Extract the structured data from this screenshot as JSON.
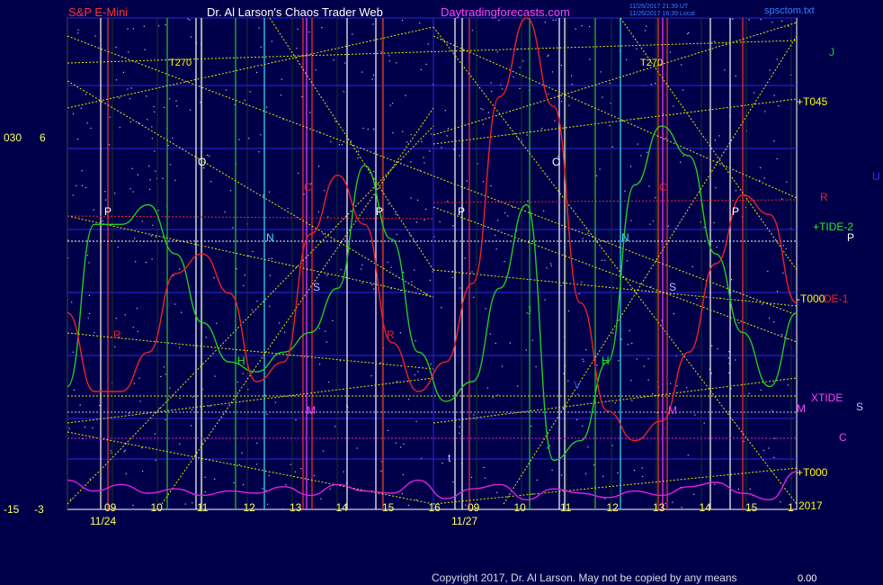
{
  "header": {
    "instrument": "S&P E-Mini",
    "site": "Dr. Al Larson's Chaos Trader Web",
    "url": "Daytradingforecasts.com",
    "stamp_line1": "11/26/2017 21:39 UT",
    "stamp_line2": "11/26/2017 16:39 Local",
    "filename": "spsctom.txt"
  },
  "footer": {
    "copyright": "Copyright 2017, Dr. Al Larson. May not be copied by any means",
    "corner_value": "0.00"
  },
  "left_scale": {
    "top_left": "030",
    "top_right": "6",
    "bottom_left": "-15",
    "bottom_right": "-3"
  },
  "right_labels": {
    "j": "J",
    "t045": "+T045",
    "u": "U",
    "r": "R",
    "tide2": "+TIDE-2",
    "p": "P",
    "t000": "-T000",
    "de1": "DE-1",
    "xtide": "XTIDE",
    "s": "S",
    "m": "M",
    "c": "C",
    "t000b": "+T000",
    "year": "2017"
  },
  "x_axis": {
    "day1_date": "11/24",
    "day2_date": "11/27",
    "day1_hours": [
      "09",
      "10",
      "11",
      "12",
      "13",
      "14",
      "15",
      "16"
    ],
    "day2_hours": [
      "09",
      "10",
      "11",
      "12",
      "13",
      "14",
      "15"
    ],
    "day2_last_hour": "1"
  },
  "in_plot_labels": {
    "t270a": "T270",
    "t270b": "T270",
    "o1": "O",
    "o2": "O",
    "p1": "P",
    "p2": "P",
    "p3": "P",
    "p4": "P",
    "n1": "N",
    "n2": "N",
    "s1": "S",
    "s2": "S",
    "h1": "H",
    "h2": "H",
    "m1": "M",
    "m2": "M",
    "c1": "C",
    "c2": "C",
    "j1": "J",
    "r1": "R",
    "r2": "R",
    "v1": "V",
    "t1": "t"
  },
  "colors": {
    "background": "#00004a",
    "grid": "#2a2ae0",
    "green_curve": "#22cc22",
    "red_curve": "#ee2222",
    "magenta_curve": "#e020e0",
    "yellow_lines": "#e8e800",
    "white_lines": "#ffffff",
    "title_red": "#ff3030",
    "title_white": "#ffffff",
    "url_magenta": "#ff40ff"
  },
  "chart_data": {
    "type": "line",
    "title": "S&P E-Mini",
    "left_axis_range": [
      -15,
      30
    ],
    "right_axis_range": [
      -3,
      6
    ],
    "days": [
      "11/24",
      "11/27"
    ],
    "series": [
      {
        "name": "+TIDE-2",
        "values": [
          0.25,
          0.58,
          0.58,
          0.62,
          0.52,
          0.38,
          0.3,
          0.28,
          0.32,
          0.36,
          0.45,
          0.7,
          0.55,
          0.32,
          0.22,
          0.26,
          0.45,
          0.62,
          0.1,
          0.14,
          0.3,
          0.66,
          0.78,
          0.72,
          0.52,
          0.36,
          0.25,
          0.4
        ]
      },
      {
        "name": "DE-1",
        "values": [
          0.4,
          0.24,
          0.24,
          0.32,
          0.48,
          0.52,
          0.44,
          0.26,
          0.3,
          0.56,
          0.68,
          0.58,
          0.34,
          0.24,
          0.3,
          0.46,
          0.84,
          1.0,
          0.82,
          0.42,
          0.2,
          0.14,
          0.18,
          0.32,
          0.5,
          0.64,
          0.6,
          0.42
        ]
      },
      {
        "name": "XTIDE",
        "values": [
          0.22,
          0.12,
          0.18,
          0.1,
          0.14,
          0.08,
          0.12,
          0.1,
          0.16,
          0.08,
          0.18,
          0.12,
          0.1,
          0.22,
          0.05,
          0.14,
          0.18,
          0.04,
          0.14,
          0.1,
          0.06,
          0.12,
          0.08,
          0.16,
          0.2,
          0.1,
          0.04,
          0.3
        ]
      }
    ]
  }
}
